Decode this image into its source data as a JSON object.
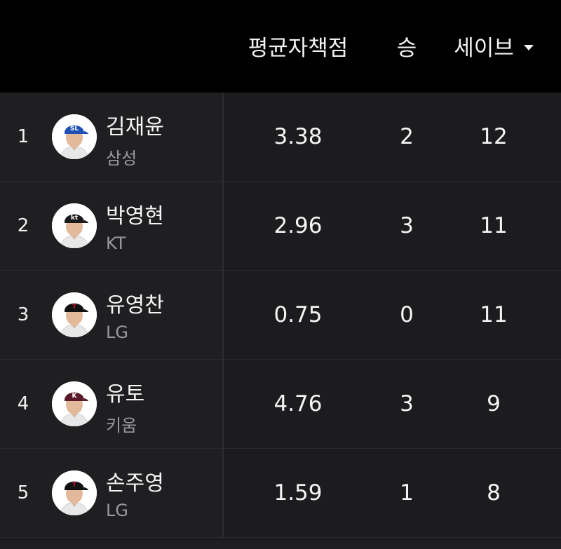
{
  "header": {
    "era_label": "평균자책점",
    "wins_label": "승",
    "saves_label": "세이브"
  },
  "rows": [
    {
      "rank": "1",
      "name": "김재윤",
      "team": "삼성",
      "era": "3.38",
      "wins": "2",
      "saves": "12",
      "cap_color": "#1d4fb5",
      "cap_logo": "SL",
      "logo_color": "#ffffff"
    },
    {
      "rank": "2",
      "name": "박영현",
      "team": "KT",
      "era": "2.96",
      "wins": "3",
      "saves": "11",
      "cap_color": "#1a1a1a",
      "cap_logo": "kt",
      "logo_color": "#ffffff"
    },
    {
      "rank": "3",
      "name": "유영찬",
      "team": "LG",
      "era": "0.75",
      "wins": "0",
      "saves": "11",
      "cap_color": "#111111",
      "cap_logo": "T",
      "logo_color": "#c8102e"
    },
    {
      "rank": "4",
      "name": "유토",
      "team": "키움",
      "era": "4.76",
      "wins": "3",
      "saves": "9",
      "cap_color": "#5a1a2a",
      "cap_logo": "K",
      "logo_color": "#ffffff"
    },
    {
      "rank": "5",
      "name": "손주영",
      "team": "LG",
      "era": "1.59",
      "wins": "1",
      "saves": "8",
      "cap_color": "#111111",
      "cap_logo": "T",
      "logo_color": "#c8102e"
    }
  ]
}
